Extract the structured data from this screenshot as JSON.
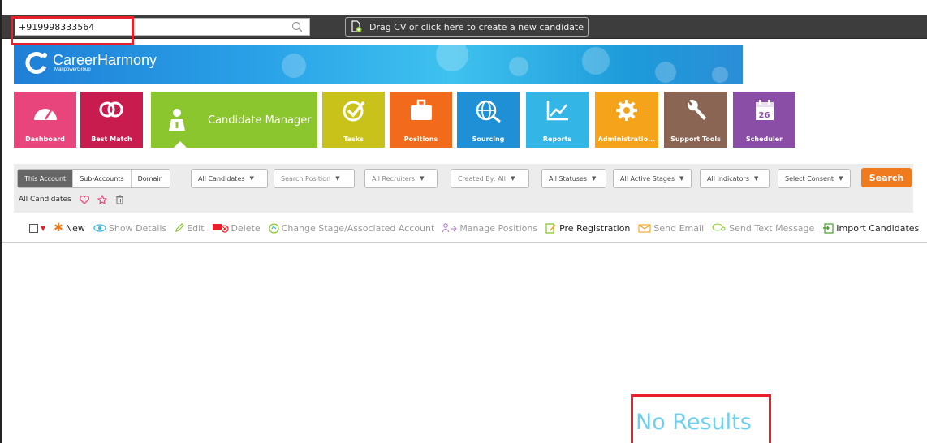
{
  "search": {
    "value": "+919998333564"
  },
  "drag_cv": {
    "label": "Drag CV or click here to create a new candidate"
  },
  "brand": {
    "name": "CareerHarmony",
    "sub": "ManpowerGroup"
  },
  "modules": [
    {
      "label": "Dashboard",
      "color": "#e8457d",
      "icon": "gauge-icon"
    },
    {
      "label": "Best Match",
      "color": "#c81c4e",
      "icon": "rings-icon"
    },
    {
      "label": "Candidate Manager",
      "color": "#8bc62e",
      "icon": "person-info-icon"
    },
    {
      "label": "Tasks",
      "color": "#c9c21a",
      "icon": "checkmark-icon"
    },
    {
      "label": "Positions",
      "color": "#f26a1c",
      "icon": "briefcase-icon"
    },
    {
      "label": "Sourcing",
      "color": "#1f8fd6",
      "icon": "globe-search-icon"
    },
    {
      "label": "Reports",
      "color": "#33b6e6",
      "icon": "chart-icon"
    },
    {
      "label": "Administratio...",
      "color": "#f4a31a",
      "icon": "gear-icon"
    },
    {
      "label": "Support Tools",
      "color": "#8a6553",
      "icon": "wrench-icon"
    },
    {
      "label": "Scheduler",
      "color": "#8b4ea6",
      "icon": "calendar-icon",
      "day": "26"
    }
  ],
  "scope_tabs": [
    "This Account",
    "Sub-Accounts",
    "Domain"
  ],
  "filters": {
    "candidates": "All Candidates",
    "position": "Search Position",
    "recruiters": "All Recruiters",
    "created_by": "Created By: All",
    "statuses": "All Statuses",
    "stages": "All Active Stages",
    "indicators": "All Indicators",
    "consent": "Select Consent",
    "search_button": "Search"
  },
  "all_candidates_label": "All Candidates",
  "actions": {
    "new": "New",
    "show_details": "Show Details",
    "edit": "Edit",
    "delete": "Delete",
    "change_stage": "Change Stage/Associated Account",
    "manage_positions": "Manage Positions",
    "pre_registration": "Pre Registration",
    "send_email": "Send Email",
    "send_text": "Send Text Message",
    "import": "Import Candidates"
  },
  "results": {
    "message": "No Results"
  },
  "colors": {
    "accent": "#f07b1e",
    "highlight": "#e8202a",
    "no_results": "#6fd0ee"
  }
}
